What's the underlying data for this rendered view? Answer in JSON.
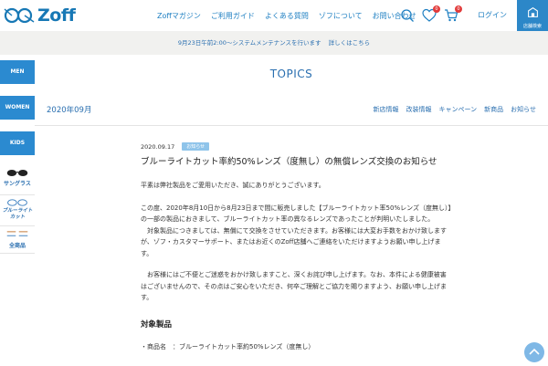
{
  "header": {
    "logo_text": "Zoff",
    "nav": [
      "Zoffマガジン",
      "ご利用ガイド",
      "よくある質問",
      "ゾフについて",
      "お問い合わせ"
    ],
    "favorites_count": "0",
    "cart_count": "0",
    "login_label": "ログイン",
    "store_search_label": "店舗検索"
  },
  "notice": {
    "text": "9月23日午前2:00～システムメンテナンスを行います",
    "more": "詳しくはこちら"
  },
  "sidebar": {
    "items": [
      "MEN",
      "WOMEN",
      "KIDS"
    ],
    "tiles": [
      "サングラス",
      "ブルーライトカット",
      "全商品"
    ]
  },
  "page": {
    "title": "TOPICS",
    "month": "2020年09月",
    "categories": [
      "新店情報",
      "改装情報",
      "キャンペーン",
      "新商品",
      "お知らせ"
    ]
  },
  "article": {
    "date": "2020.09.17",
    "tag": "お知らせ",
    "title": "ブルーライトカット率約50%レンズ（度無し）の無償レンズ交換のお知らせ",
    "p1": "平素は弊社製品をご愛用いただき、誠にありがとうございます。",
    "p2": "この度、2020年8月10日から8月23日まで間に販売しました【ブルーライトカット率50%レンズ（度無し）】の一部の製品におきまして、ブルーライトカット率の異なるレンズであったことが判明いたしました。",
    "p3": "　対象製品につきましては、無償にて交換をさせていただきます。お客様には大変お手数をおかけ致しますが、ゾフ・カスタマーサポート、またはお近くのZoff店舗へご連絡をいただけますようお願い申し上げます。",
    "p4": "　お客様にはご不便とご迷惑をおかけ致しますこと、深くお詫び申し上げます。なお、本件による健康被害はございませんので、その点はご安心をいただき、何卒ご理解とご協力を賜りますよう、お願い申し上げます。",
    "section": "対象製品",
    "item": "・商品名　：ブルーライトカット率約50%レンズ（度無し）"
  }
}
